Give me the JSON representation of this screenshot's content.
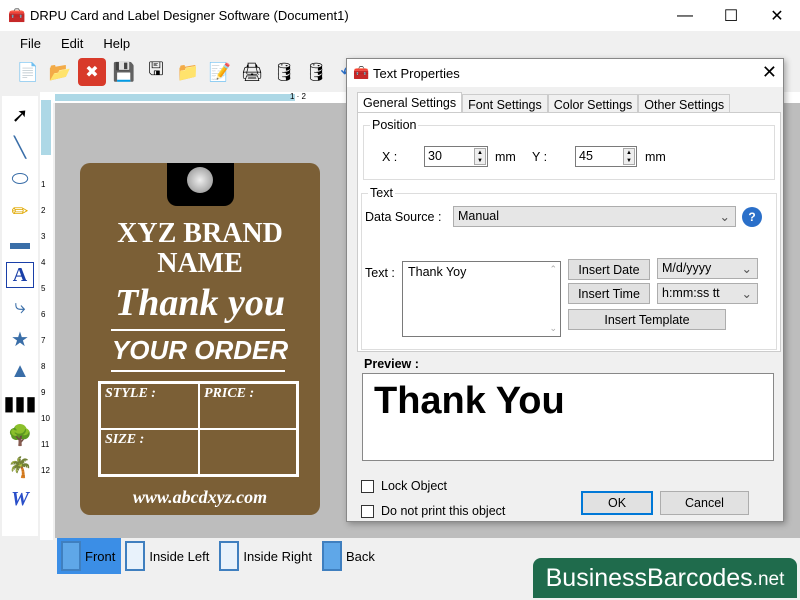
{
  "window": {
    "title": "DRPU Card and Label Designer Software (Document1)",
    "minimize": "—",
    "maximize": "☐",
    "close": "✕"
  },
  "menu": [
    "File",
    "Edit",
    "Help"
  ],
  "toolbar": [
    "new-icon",
    "open-icon",
    "close-icon",
    "save-icon",
    "save-as-icon",
    "export-icon",
    "edit-icon",
    "print-icon",
    "database-add-icon",
    "database-icon",
    "undo-icon"
  ],
  "toolbox": [
    "select-move-icon",
    "line-icon",
    "ellipse-icon",
    "pencil-icon",
    "rectangle-icon",
    "text-icon",
    "curve-icon",
    "star-icon",
    "triangle-icon",
    "barcode-icon",
    "image-icon",
    "image-library-icon",
    "wordart-icon"
  ],
  "ruler": {
    "v": [
      "1",
      "2",
      "3",
      "4",
      "5",
      "6",
      "7",
      "8",
      "9",
      "10",
      "11",
      "12"
    ],
    "h": "1 · 2"
  },
  "card": {
    "brand1": "XYZ BRAND",
    "brand2": "NAME",
    "thank": "Thank you",
    "order": "YOUR ORDER",
    "style": "STYLE :",
    "price": "PRICE :",
    "size": "SIZE :",
    "web": "www.abcdxyz.com",
    "color": "#7b5f36"
  },
  "pages": [
    {
      "label": "Front",
      "active": true
    },
    {
      "label": "Inside Left"
    },
    {
      "label": "Inside Right"
    },
    {
      "label": "Back"
    }
  ],
  "watermark": {
    "main": "BusinessBarcodes",
    "suffix": ".net"
  },
  "dialog": {
    "title": "Text Properties",
    "close": "✕",
    "tabs": [
      "General Settings",
      "Font Settings",
      "Color Settings",
      "Other Settings"
    ],
    "position": {
      "legend": "Position",
      "x_label": "X :",
      "x": "30",
      "x_unit": "mm",
      "y_label": "Y :",
      "y": "45",
      "y_unit": "mm"
    },
    "text": {
      "legend": "Text",
      "source_label": "Data Source :",
      "source": "Manual",
      "text_label": "Text :",
      "value": "Thank Yoy",
      "insert_date": "Insert Date",
      "date_format": "M/d/yyyy",
      "insert_time": "Insert Time",
      "time_format": "h:mm:ss tt",
      "insert_template": "Insert Template"
    },
    "preview_label": "Preview :",
    "preview": "Thank You",
    "lock": "Lock Object",
    "noprint": "Do not print this object",
    "ok": "OK",
    "cancel": "Cancel"
  }
}
